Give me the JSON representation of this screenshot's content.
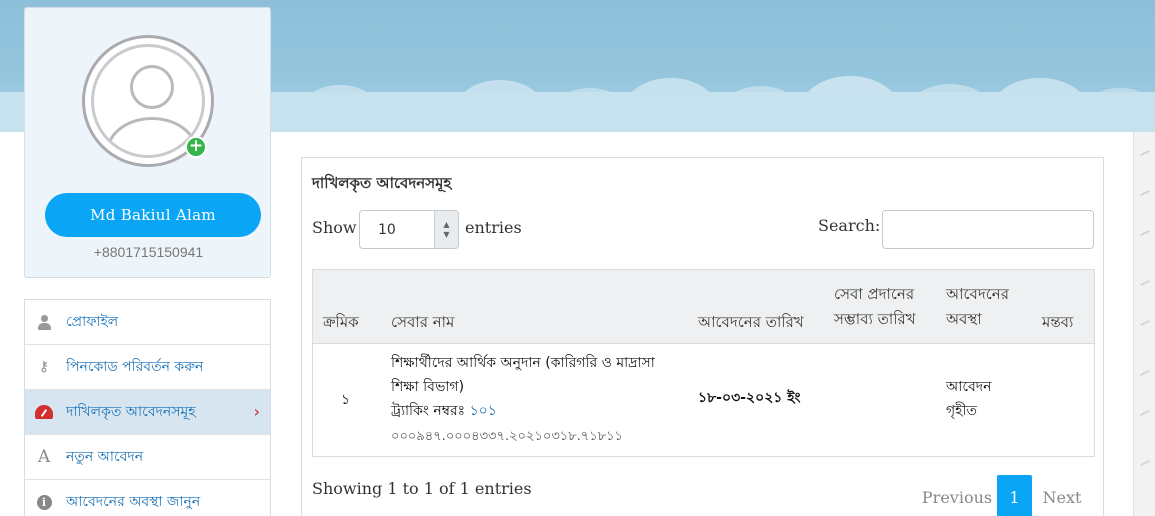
{
  "profile": {
    "name": "Md Bakiul Alam",
    "phone": "+8801715150941",
    "add_badge": "+"
  },
  "menu": {
    "items": [
      {
        "label": "প্রোফাইল",
        "icon": "user-icon"
      },
      {
        "label": "পিনকোড পরিবর্তন করুন",
        "icon": "key-icon"
      },
      {
        "label": "দাখিলকৃত আবেদনসমূহ",
        "icon": "dashboard-icon",
        "active": true
      },
      {
        "label": "নতুন আবেদন",
        "icon": "font-a-icon"
      },
      {
        "label": "আবেদনের অবস্থা জানুন",
        "icon": "info-icon"
      }
    ],
    "active_chevron": "›",
    "key_glyph": "⚷",
    "a_glyph": "A",
    "info_glyph": "i"
  },
  "panel": {
    "title": "দাখিলকৃত আবেদনসমূহ",
    "show_label": "Show",
    "entries_value": "10",
    "entries_label": "entries",
    "search_label": "Search:",
    "search_value": "",
    "info": "Showing 1 to 1 of 1 entries",
    "pagination": {
      "previous": "Previous",
      "current": "1",
      "next": "Next"
    }
  },
  "table": {
    "headers": {
      "serial": "ক্রমিক",
      "service": "সেবার নাম",
      "date": "আবেদনের তারিখ",
      "delivery_line1": "সেবা প্রদানের",
      "delivery_line2": "সম্ভাব্য তারিখ",
      "status_line1": "আবেদনের",
      "status_line2": "অবস্থা",
      "remarks": "মন্তব্য"
    },
    "rows": [
      {
        "serial": "১",
        "service_line1": "শিক্ষার্থীদের আর্থিক অনুদান (কারিগরি ও মাদ্রাসা",
        "service_line2": "শিক্ষা বিভাগ)",
        "tracking_label": "ট্র্যাকিং নম্বরঃ",
        "tracking_number": "১০১",
        "tracking_code": "০০০৯৪৭.০০০৪৩৩৭.২০২১০৩১৮.৭১৮১১",
        "date": "১৮-০৩-২০২১ ইং",
        "delivery_date": "",
        "status_line1": "আবেদন",
        "status_line2": "গৃহীত",
        "remarks": ""
      }
    ]
  },
  "colors": {
    "accent": "#0aa5f5",
    "link": "#1570b8",
    "active_icon": "#c62828",
    "sky": "#8dbfd9"
  }
}
